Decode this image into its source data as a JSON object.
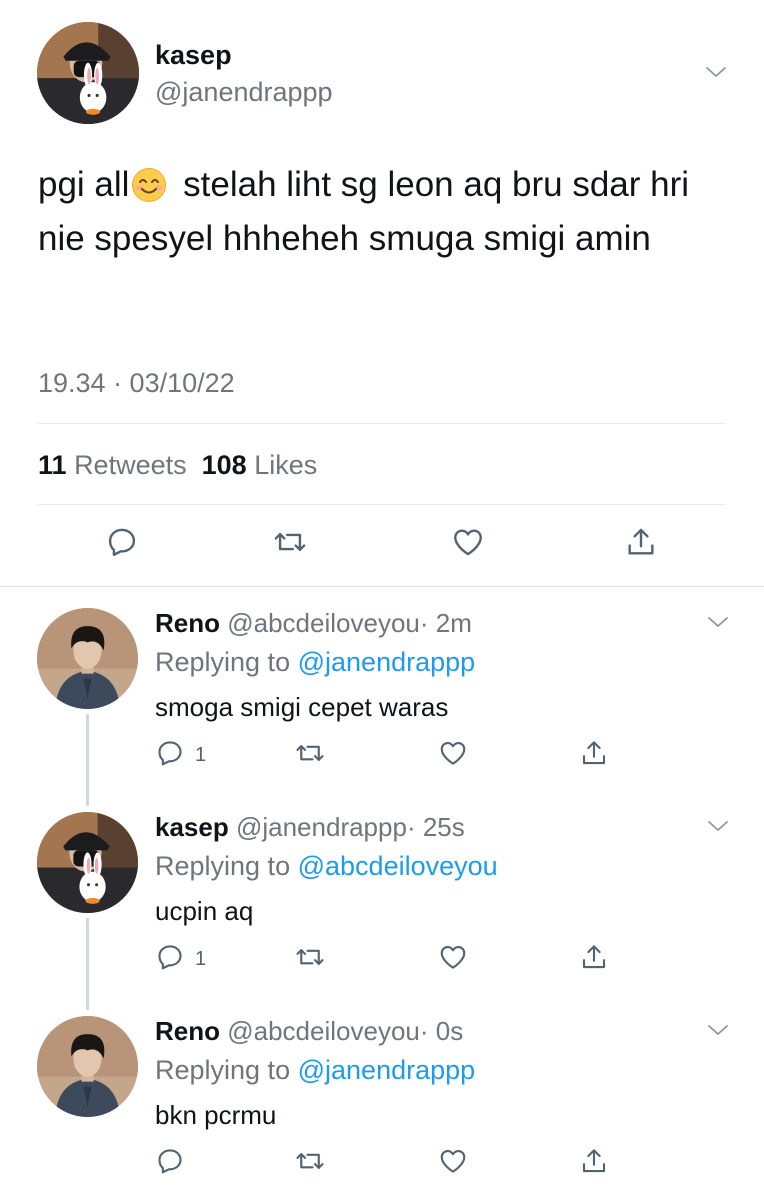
{
  "main_tweet": {
    "author": {
      "name": "kasep",
      "handle": "@janendrappp",
      "avatar_icon": "avatar-photo-kasep"
    },
    "text_before_emoji": "pgi all",
    "emoji_icon": "smiling-face-emoji",
    "text_after_emoji": " stelah liht sg leon aq bru sdar hri nie spesyel hhheheh smuga smigi amin",
    "timestamp": "19.34 · 03/10/22",
    "retweets": {
      "count": "11",
      "label": "Retweets"
    },
    "likes": {
      "count": "108",
      "label": "Likes"
    }
  },
  "replies": [
    {
      "name": "Reno",
      "handle": "@abcdeiloveyou",
      "time": "· 2m",
      "replying_label": "Replying to",
      "replying_to": "@janendrappp",
      "text": "smoga smigi cepet waras",
      "reply_count": "1"
    },
    {
      "name": "kasep",
      "handle": "@janendrappp",
      "time": "· 25s",
      "replying_label": "Replying to",
      "replying_to": "@abcdeiloveyou",
      "text": "ucpin aq",
      "reply_count": "1"
    },
    {
      "name": "Reno",
      "handle": "@abcdeiloveyou",
      "time": "· 0s",
      "replying_label": "Replying to",
      "replying_to": "@janendrappp",
      "text": "bkn pcrmu",
      "reply_count": ""
    }
  ],
  "icons": {
    "reply": "reply-icon",
    "retweet": "retweet-icon",
    "like": "heart-icon",
    "share": "share-icon",
    "more": "chevron-down-icon"
  },
  "colors": {
    "text": "#0f1419",
    "secondary": "#6e767d",
    "link": "#1d9bf0",
    "divider": "#e6ecf0"
  }
}
